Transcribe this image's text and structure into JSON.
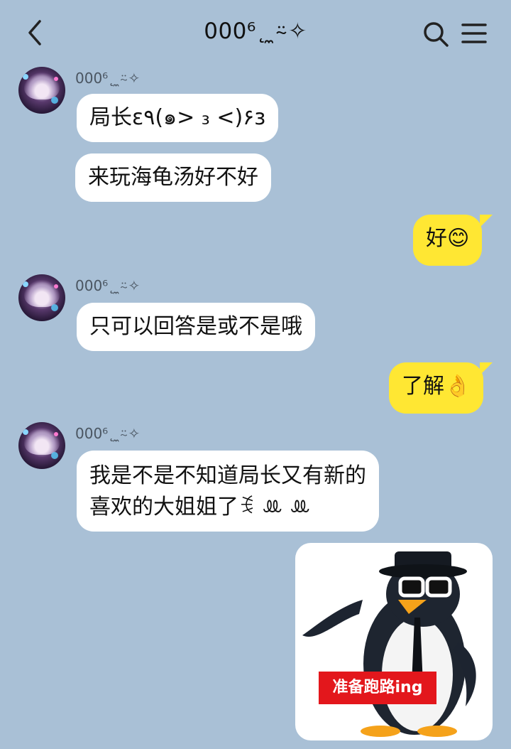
{
  "header": {
    "title": "000⁶˛ ̼⍨✧"
  },
  "messages": [
    {
      "sender": "000⁶˛ ̼⍨✧",
      "lines": [
        "局长ε٩(๑> ₃ <)۶з",
        "来玩海龟汤好不好"
      ]
    },
    {
      "me": "好😊"
    },
    {
      "sender": "000⁶˛ ̼⍨✧",
      "lines": [
        "只可以回答是或不是哦"
      ]
    },
    {
      "me": "了解👌"
    },
    {
      "sender": "000⁶˛ ̼⍨✧",
      "lines": [
        "我是不是不知道局长又有新的",
        "喜欢的大姐姐了ꉂ ꔛ ꔛ"
      ]
    }
  ],
  "sticker": {
    "caption": "准备跑路ing"
  }
}
